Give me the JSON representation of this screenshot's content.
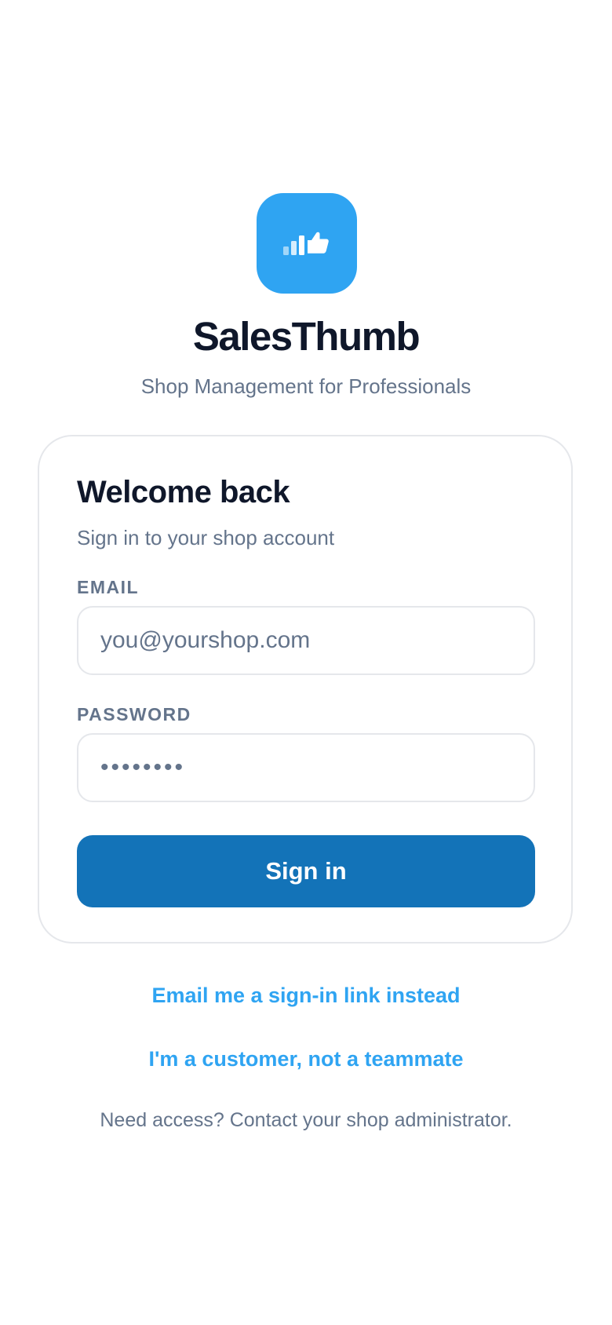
{
  "brand": {
    "app_name": "SalesThumb",
    "tagline": "Shop Management for Professionals",
    "logo_icon": "chart-thumbs-up-icon",
    "accent_color": "#2fa4f2"
  },
  "login_card": {
    "title": "Welcome back",
    "subtitle": "Sign in to your shop account",
    "email": {
      "label": "EMAIL",
      "placeholder": "you@yourshop.com",
      "value": ""
    },
    "password": {
      "label": "PASSWORD",
      "value_masked": "••••••••"
    },
    "sign_in_button": {
      "label": "Sign in",
      "color": "#1373b8"
    }
  },
  "links": {
    "magic_link": "Email me a sign-in link instead",
    "customer_link": "I'm a customer, not a teammate"
  },
  "footer": {
    "note": "Need access? Contact your shop administrator."
  }
}
